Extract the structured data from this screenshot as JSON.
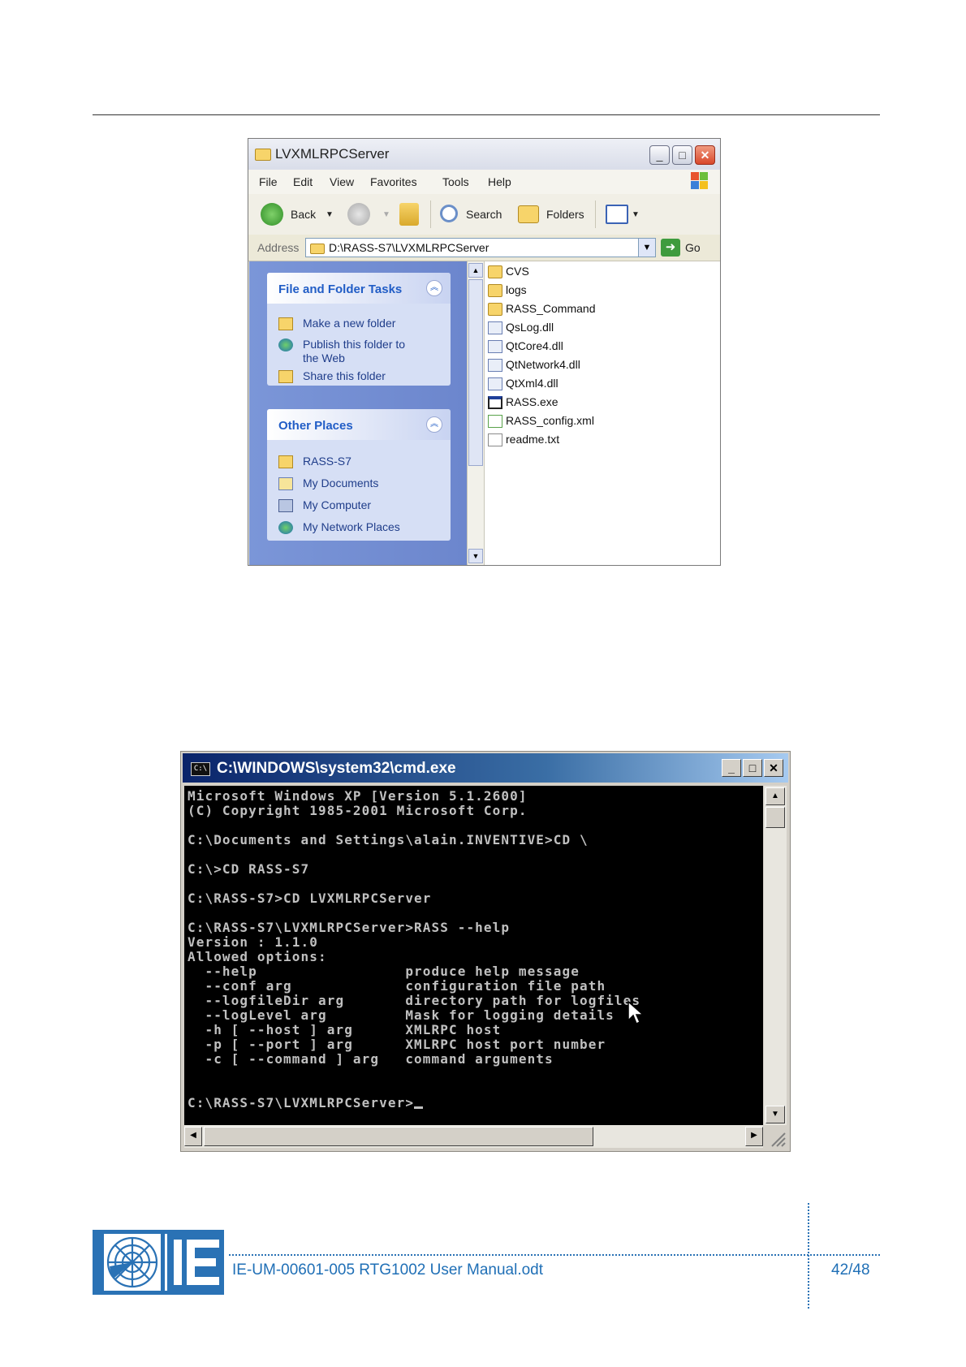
{
  "explorer": {
    "title": "LVXMLRPCServer",
    "menu": [
      "File",
      "Edit",
      "View",
      "Favorites",
      "Tools",
      "Help"
    ],
    "toolbar": {
      "back": "Back",
      "search": "Search",
      "folders": "Folders"
    },
    "address_label": "Address",
    "address_value": "D:\\RASS-S7\\LVXMLRPCServer",
    "go_label": "Go",
    "file_tasks": {
      "heading": "File and Folder Tasks",
      "items": [
        "Make a new folder",
        "Publish this folder to",
        "the Web",
        "Share this folder"
      ]
    },
    "other_places": {
      "heading": "Other Places",
      "items": [
        "RASS-S7",
        "My Documents",
        "My Computer",
        "My Network Places"
      ]
    },
    "files": [
      {
        "name": "CVS",
        "icon": "folder-icon"
      },
      {
        "name": "logs",
        "icon": "folder-icon"
      },
      {
        "name": "RASS_Command",
        "icon": "folder-icon"
      },
      {
        "name": "QsLog.dll",
        "icon": "dll-file-icon"
      },
      {
        "name": "QtCore4.dll",
        "icon": "dll-file-icon"
      },
      {
        "name": "QtNetwork4.dll",
        "icon": "dll-file-icon"
      },
      {
        "name": "QtXml4.dll",
        "icon": "dll-file-icon"
      },
      {
        "name": "RASS.exe",
        "icon": "exe-file-icon"
      },
      {
        "name": "RASS_config.xml",
        "icon": "xml-file-icon"
      },
      {
        "name": "readme.txt",
        "icon": "text-file-icon"
      }
    ]
  },
  "cmd": {
    "title": "C:\\WINDOWS\\system32\\cmd.exe",
    "icon_text": "C:\\",
    "lines": [
      "Microsoft Windows XP [Version 5.1.2600]",
      "(C) Copyright 1985-2001 Microsoft Corp.",
      "",
      "C:\\Documents and Settings\\alain.INVENTIVE>CD \\",
      "",
      "C:\\>CD RASS-S7",
      "",
      "C:\\RASS-S7>CD LVXMLRPCServer",
      "",
      "C:\\RASS-S7\\LVXMLRPCServer>RASS --help",
      "Version : 1.1.0",
      "Allowed options:",
      "  --help                 produce help message",
      "  --conf arg             configuration file path",
      "  --logfileDir arg       directory path for logfiles",
      "  --logLevel arg         Mask for logging details",
      "  -h [ --host ] arg      XMLRPC host",
      "  -p [ --port ] arg      XMLRPC host port number",
      "  -c [ --command ] arg   command arguments",
      "",
      ""
    ],
    "prompt": "C:\\RASS-S7\\LVXMLRPCServer>"
  },
  "footer": {
    "document": "IE-UM-00601-005 RTG1002 User Manual.odt",
    "page": "42/48"
  },
  "colors": {
    "footer_blue": "#1f6fb6",
    "logo_blue": "#2a72b5",
    "task_link": "#1f3d8a"
  }
}
